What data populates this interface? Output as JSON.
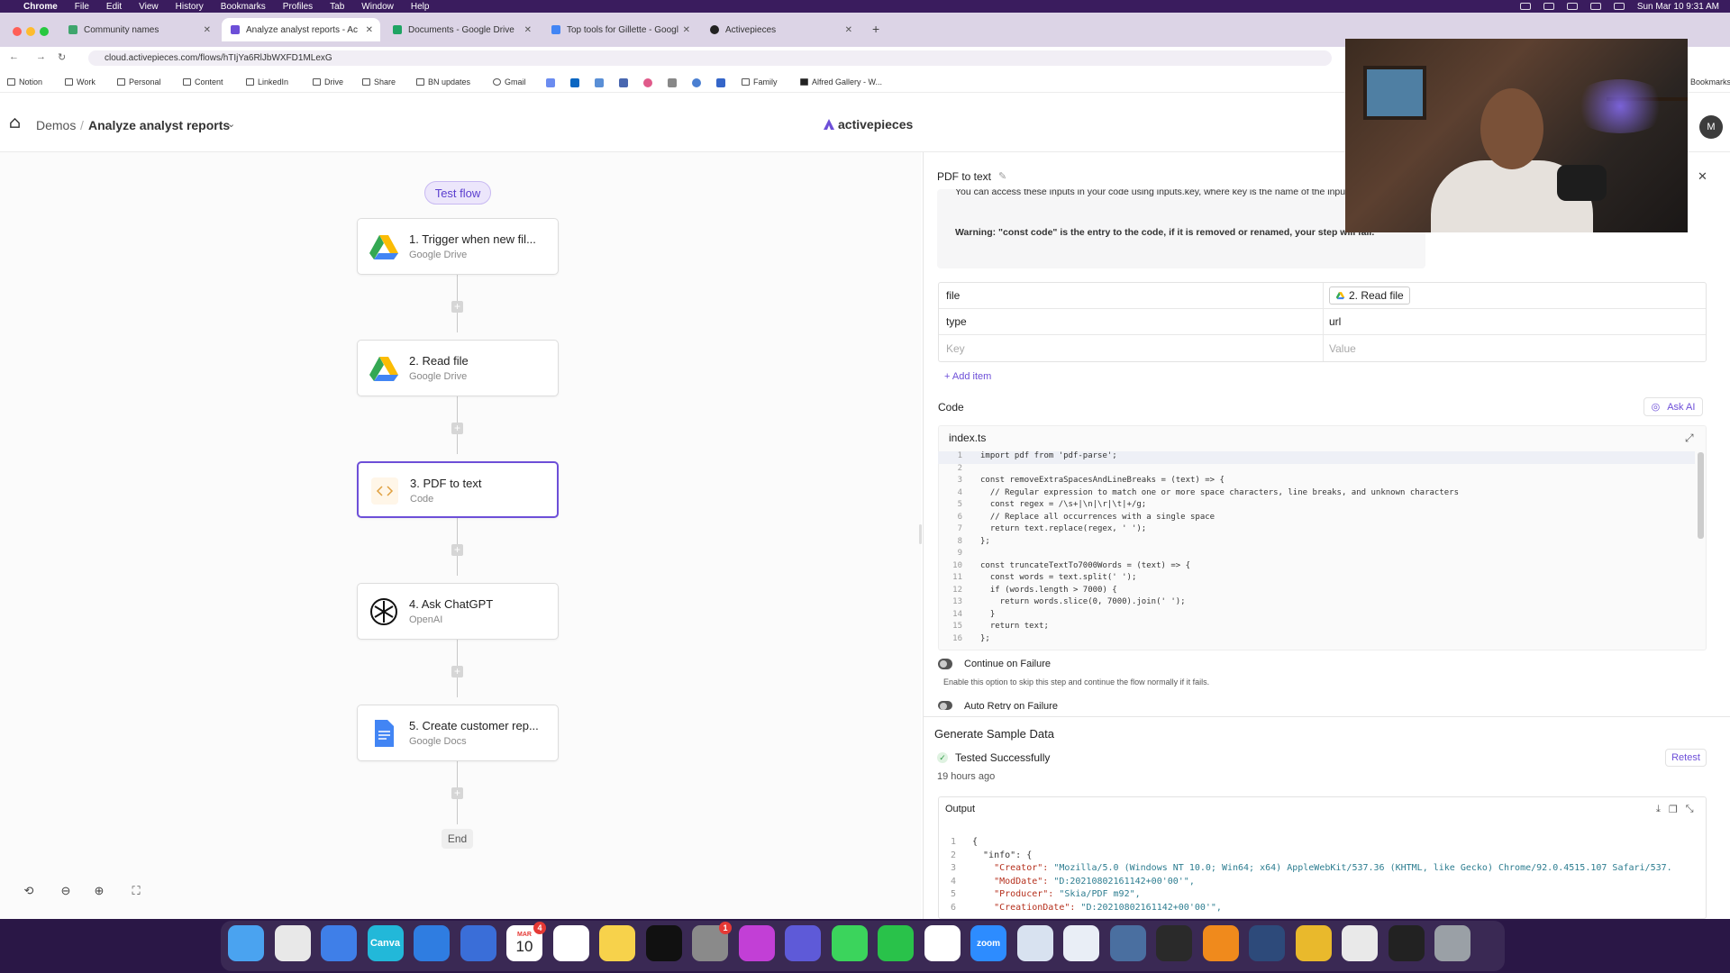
{
  "menubar": {
    "items": [
      "Chrome",
      "File",
      "Edit",
      "View",
      "History",
      "Bookmarks",
      "Profiles",
      "Tab",
      "Window",
      "Help"
    ],
    "datetime": "Sun Mar 10  9:31 AM"
  },
  "browser": {
    "tabs": [
      {
        "label": "Community names",
        "color": "#3fa56d"
      },
      {
        "label": "Analyze analyst reports - Ac",
        "color": "#6d4fd8"
      },
      {
        "label": "Documents - Google Drive",
        "color": "#1fa463"
      },
      {
        "label": "Top tools for Gillette - Googl",
        "color": "#4285f4"
      },
      {
        "label": "Activepieces",
        "color": "#222222"
      }
    ],
    "url": "cloud.activepieces.com/flows/hTIjYa6RlJbWXFD1MLexG",
    "bookmarks": [
      "Notion",
      "Work",
      "Personal",
      "Content",
      "LinkedIn",
      "Drive",
      "Share",
      "BN updates",
      "Gmail",
      "Family",
      "Alfred Gallery - W..."
    ],
    "bookmarks_overflow": "Bookmarks"
  },
  "app": {
    "breadcrumb_root": "Demos",
    "flow_name": "Analyze analyst reports",
    "brand": "activepieces",
    "avatar_initial": "M",
    "accent": "#6d4fd8"
  },
  "canvas": {
    "test_flow": "Test flow",
    "steps": [
      {
        "title": "1. Trigger when new fil...",
        "subtitle": "Google Drive",
        "icon": "google-drive-icon"
      },
      {
        "title": "2. Read file",
        "subtitle": "Google Drive",
        "icon": "google-drive-icon"
      },
      {
        "title": "3. PDF to text",
        "subtitle": "Code",
        "icon": "code-icon"
      },
      {
        "title": "4. Ask ChatGPT",
        "subtitle": "OpenAI",
        "icon": "openai-icon"
      },
      {
        "title": "5. Create customer rep...",
        "subtitle": "Google Docs",
        "icon": "google-docs-icon"
      }
    ],
    "end_label": "End"
  },
  "panel": {
    "title": "PDF to text",
    "notice_line1": "You can access these inputs in your code using inputs.key, where key is the name of the input. below.",
    "notice_warning": "Warning: \"const code\" is the entry to the code, if it is removed or renamed, your step will fail.",
    "inputs": [
      {
        "key": "file",
        "value": "2. Read file"
      },
      {
        "key": "type",
        "value": "url"
      }
    ],
    "key_placeholder": "Key",
    "value_placeholder": "Value",
    "add_item": "+ Add item",
    "code_label": "Code",
    "ask_ai": "Ask AI",
    "file_name": "index.ts",
    "code_lines": [
      "import pdf from 'pdf-parse';",
      "",
      "const removeExtraSpacesAndLineBreaks = (text) => {",
      "  // Regular expression to match one or more space characters, line breaks, and unknown characters",
      "  const regex = /\\s+|\\n|\\r|\\t|+/g;",
      "  // Replace all occurrences with a single space",
      "  return text.replace(regex, ' ');",
      "};",
      "",
      "const truncateTextTo7000Words = (text) => {",
      "  const words = text.split(' ');",
      "  if (words.length > 7000) {",
      "    return words.slice(0, 7000).join(' ');",
      "  }",
      "  return text;",
      "};"
    ],
    "continue_on_failure": "Continue on Failure",
    "continue_desc": "Enable this option to skip this step and continue the flow normally if it fails.",
    "auto_retry": "Auto Retry on Failure",
    "sample_title": "Generate Sample Data",
    "tested": "Tested Successfully",
    "tested_ago": "19 hours ago",
    "retest": "Retest",
    "output_label": "Output",
    "output_lines": [
      {
        "plain": "{"
      },
      {
        "plain": "  \"info\": {"
      },
      {
        "key": "    \"Creator\": ",
        "str": "\"Mozilla/5.0 (Windows NT 10.0; Win64; x64) AppleWebKit/537.36 (KHTML, like Gecko) Chrome/92.0.4515.107 Safari/537."
      },
      {
        "key": "    \"ModDate\": ",
        "str": "\"D:20210802161142+00'00'\","
      },
      {
        "key": "    \"Producer\": ",
        "str": "\"Skia/PDF m92\","
      },
      {
        "key": "    \"CreationDate\": ",
        "str": "\"D:20210802161142+00'00'\","
      }
    ]
  },
  "dock": {
    "apps": [
      "finder-icon",
      "chrome-icon",
      "mail-icon",
      "canva-icon",
      "onedrive-icon",
      "safari-icon",
      "calendar-icon",
      "reminders-icon",
      "notes-icon",
      "readwise-icon",
      "settings-icon",
      "focus-icon",
      "linear-icon",
      "messages-icon",
      "whatsapp-icon",
      "slack-icon",
      "zoom-icon",
      "tableplus-icon",
      "airmail-icon",
      "preview-icon",
      "obs-icon",
      "vlc-icon",
      "photo-icon",
      "sun-icon",
      "downloads-icon",
      "terminal-icon",
      "trash-icon"
    ],
    "canva_label": "Canva",
    "zoom_label": "zoom",
    "calendar_month": "MAR",
    "calendar_day": "10",
    "calendar_badge": "4",
    "settings_badge": "1"
  }
}
